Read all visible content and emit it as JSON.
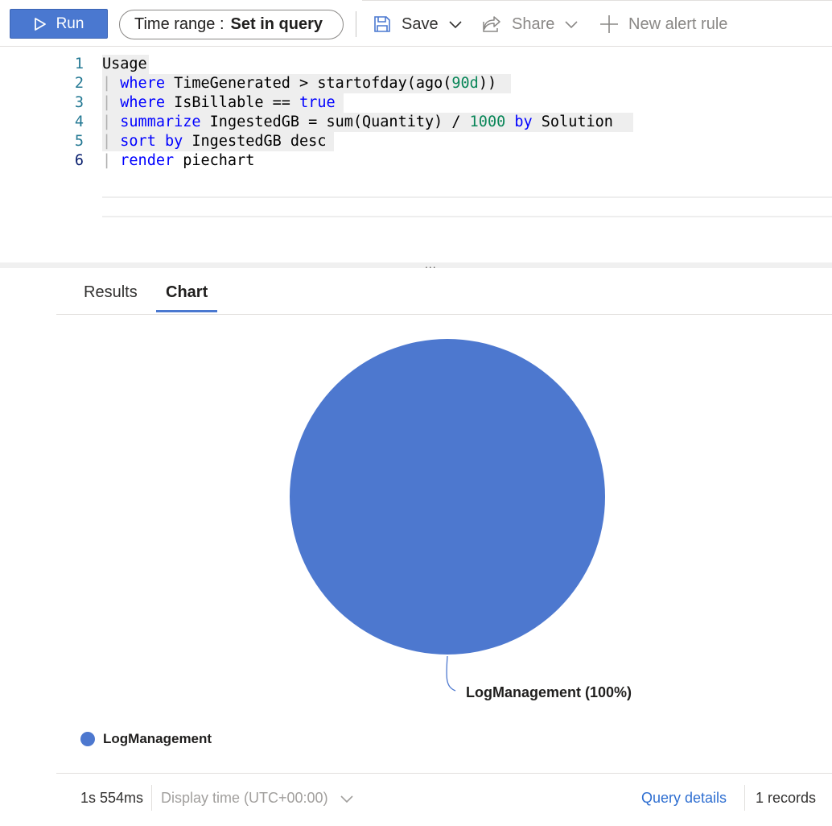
{
  "toolbar": {
    "run_label": "Run",
    "time_range_label": "Time range :",
    "time_range_value": "Set in query",
    "save_label": "Save",
    "share_label": "Share",
    "new_alert_label": "New alert rule"
  },
  "editor": {
    "line_numbers": [
      "1",
      "2",
      "3",
      "4",
      "5",
      "6"
    ],
    "lines": [
      [
        {
          "t": "Usage",
          "c": "plain"
        }
      ],
      [
        {
          "t": "| ",
          "c": "pipe"
        },
        {
          "t": "where",
          "c": "kw"
        },
        {
          "t": " TimeGenerated > startofday(ago(",
          "c": "plain"
        },
        {
          "t": "90d",
          "c": "num"
        },
        {
          "t": "))",
          "c": "plain"
        }
      ],
      [
        {
          "t": "| ",
          "c": "pipe"
        },
        {
          "t": "where",
          "c": "kw"
        },
        {
          "t": " IsBillable == ",
          "c": "plain"
        },
        {
          "t": "true",
          "c": "kw"
        }
      ],
      [
        {
          "t": "| ",
          "c": "pipe"
        },
        {
          "t": "summarize",
          "c": "kw"
        },
        {
          "t": " IngestedGB = sum(Quantity) / ",
          "c": "plain"
        },
        {
          "t": "1000",
          "c": "num"
        },
        {
          "t": " ",
          "c": "plain"
        },
        {
          "t": "by",
          "c": "kw"
        },
        {
          "t": " Solution",
          "c": "plain"
        }
      ],
      [
        {
          "t": "| ",
          "c": "pipe"
        },
        {
          "t": "sort by",
          "c": "kw"
        },
        {
          "t": " IngestedGB desc",
          "c": "plain"
        }
      ],
      [
        {
          "t": "| ",
          "c": "pipe"
        },
        {
          "t": "render",
          "c": "kw"
        },
        {
          "t": " piechart",
          "c": "plain"
        }
      ]
    ]
  },
  "splitter": {
    "label": "..."
  },
  "tabs": [
    {
      "label": "Results",
      "selected": false
    },
    {
      "label": "Chart",
      "selected": true
    }
  ],
  "chart_data": {
    "type": "pie",
    "categories": [
      "LogManagement"
    ],
    "values": [
      100
    ],
    "slice_labels": [
      "LogManagement (100%)"
    ],
    "colors": [
      "#4d78cf"
    ],
    "legend": [
      "LogManagement"
    ],
    "legend_position": "bottom-left"
  },
  "status": {
    "elapsed": "1s 554ms",
    "display_time": "Display time (UTC+00:00)",
    "query_details": "Query details",
    "records": "1 records"
  },
  "colors": {
    "accent": "#4a78d0",
    "link": "#2f6fd1",
    "keyword": "#0000ff",
    "number": "#098658"
  },
  "icons": {
    "run": "play-icon",
    "save": "save-icon",
    "share": "share-icon",
    "new_alert": "plus-icon",
    "dropdown": "chevron-down-icon"
  }
}
